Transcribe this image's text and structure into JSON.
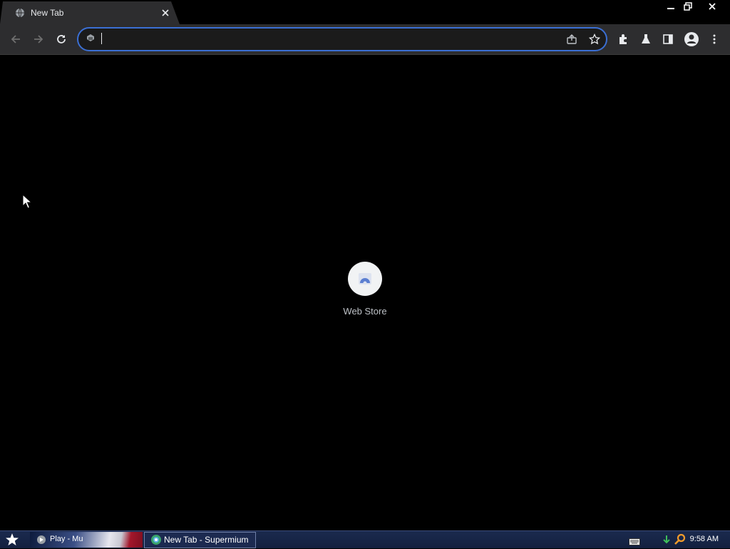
{
  "browser": {
    "tab": {
      "title": "New Tab",
      "favicon": "globe-icon"
    },
    "window_controls": {
      "minimize": "minimize-icon",
      "restore": "restore-icon",
      "close": "close-icon"
    },
    "toolbar": {
      "back": "arrow-left-icon",
      "forward": "arrow-right-icon",
      "reload": "reload-icon",
      "omnibox": {
        "value": "",
        "placeholder": "",
        "site_icon": "site-info-icon"
      },
      "share": "share-icon",
      "bookmark": "star-icon",
      "extensions": "puzzle-icon",
      "labs": "flask-icon",
      "side_panel": "side-panel-icon",
      "profile": "avatar-icon",
      "menu": "kebab-menu-icon"
    },
    "accent_color": "#3b6fd4"
  },
  "new_tab": {
    "shortcuts": [
      {
        "label": "Web Store",
        "icon": "web-store-icon"
      }
    ]
  },
  "taskbar": {
    "start_icon": "star-icon",
    "tasks": [
      {
        "label": "Play - Mu"
      },
      {
        "label": "New Tab - Supermium"
      }
    ],
    "tray_icons": [
      "keyboard-icon",
      "network-icon",
      "search-icon"
    ],
    "clock": "9:58 AM"
  }
}
